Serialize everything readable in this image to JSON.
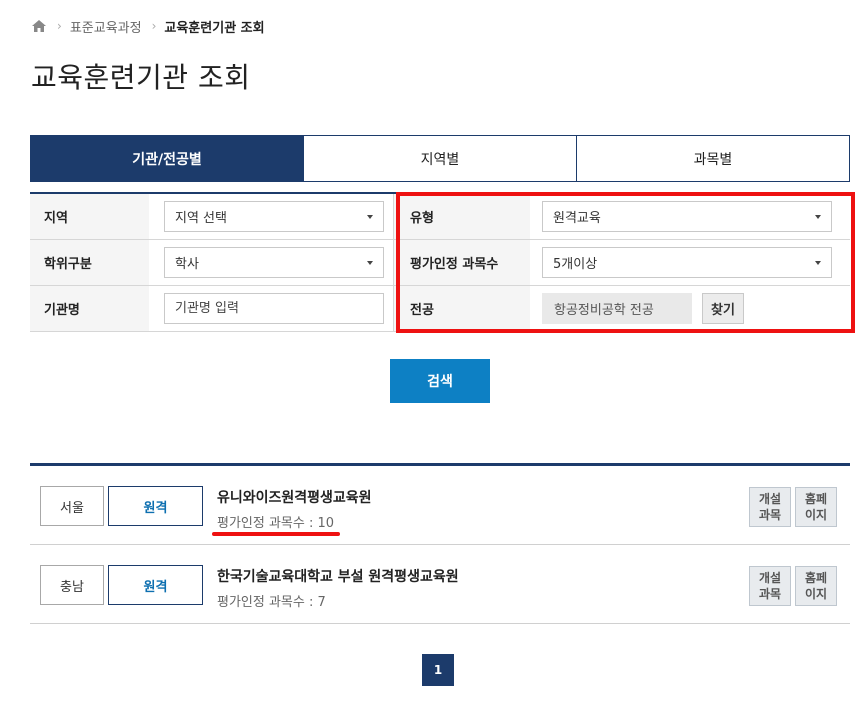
{
  "breadcrumb": {
    "home_icon": "home-icon",
    "items": [
      "표준교육과정",
      "교육훈련기관 조회"
    ]
  },
  "page_title": "교육훈련기관 조회",
  "tabs": [
    {
      "label": "기관/전공별",
      "active": true
    },
    {
      "label": "지역별",
      "active": false
    },
    {
      "label": "과목별",
      "active": false
    }
  ],
  "filters": {
    "region": {
      "label": "지역",
      "value": "지역 선택"
    },
    "degree": {
      "label": "학위구분",
      "value": "학사"
    },
    "institution": {
      "label": "기관명",
      "placeholder": "기관명 입력"
    },
    "type": {
      "label": "유형",
      "value": "원격교육"
    },
    "course_count": {
      "label": "평가인정 과목수",
      "value": "5개이상"
    },
    "major": {
      "label": "전공",
      "value": "항공정비공학 전공",
      "find_label": "찾기"
    }
  },
  "search_label": "검색",
  "results": [
    {
      "region": "서울",
      "type": "원격",
      "name": "유니와이즈원격평생교육원",
      "count_text": "평가인정 과목수 : 10",
      "open_course_label": "개설\n과목",
      "homepage_label": "홈페\n이지"
    },
    {
      "region": "충남",
      "type": "원격",
      "name": "한국기술교육대학교 부설 원격평생교육원",
      "count_text": "평가인정 과목수 : 7",
      "open_course_label": "개설\n과목",
      "homepage_label": "홈페\n이지"
    }
  ],
  "pagination": {
    "current": "1"
  },
  "colors": {
    "navy": "#1c3b6b",
    "search_blue": "#0d80c4",
    "highlight_red": "#ee1111"
  }
}
